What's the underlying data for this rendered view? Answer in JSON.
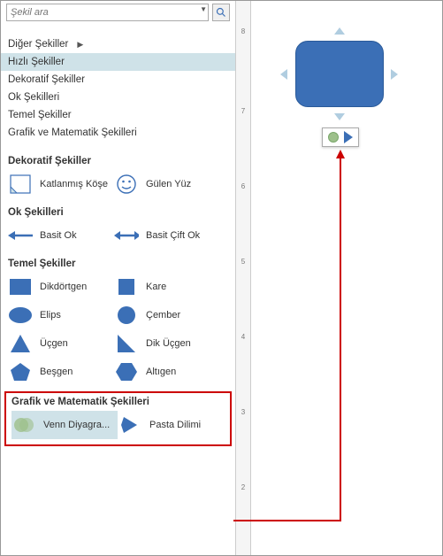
{
  "search": {
    "placeholder": "Şekil ara"
  },
  "categories": [
    {
      "label": "Diğer Şekiller",
      "has_sub": true
    },
    {
      "label": "Hızlı Şekiller",
      "selected": true
    },
    {
      "label": "Dekoratif Şekiller"
    },
    {
      "label": "Ok Şekilleri"
    },
    {
      "label": "Temel Şekiller"
    },
    {
      "label": "Grafik ve Matematik Şekilleri"
    }
  ],
  "sections": {
    "decorative": {
      "title": "Dekoratif Şekiller",
      "items": [
        {
          "label": "Katlanmış Köşe"
        },
        {
          "label": "Gülen Yüz"
        }
      ]
    },
    "arrows": {
      "title": "Ok Şekilleri",
      "items": [
        {
          "label": "Basit Ok"
        },
        {
          "label": "Basit Çift Ok"
        }
      ]
    },
    "basic": {
      "title": "Temel Şekiller",
      "items": [
        {
          "label": "Dikdörtgen"
        },
        {
          "label": "Kare"
        },
        {
          "label": "Elips"
        },
        {
          "label": "Çember"
        },
        {
          "label": "Üçgen"
        },
        {
          "label": "Dik Üçgen"
        },
        {
          "label": "Beşgen"
        },
        {
          "label": "Altıgen"
        }
      ]
    },
    "math": {
      "title": "Grafik ve Matematik Şekilleri",
      "items": [
        {
          "label": "Venn Diyagra..."
        },
        {
          "label": "Pasta Dilimi"
        }
      ]
    }
  },
  "ruler_ticks": [
    "8",
    "7",
    "6",
    "5",
    "4",
    "3",
    "2"
  ],
  "colors": {
    "accent": "#3b6fb6",
    "highlight": "#c00",
    "selection": "#cfe2e8"
  }
}
